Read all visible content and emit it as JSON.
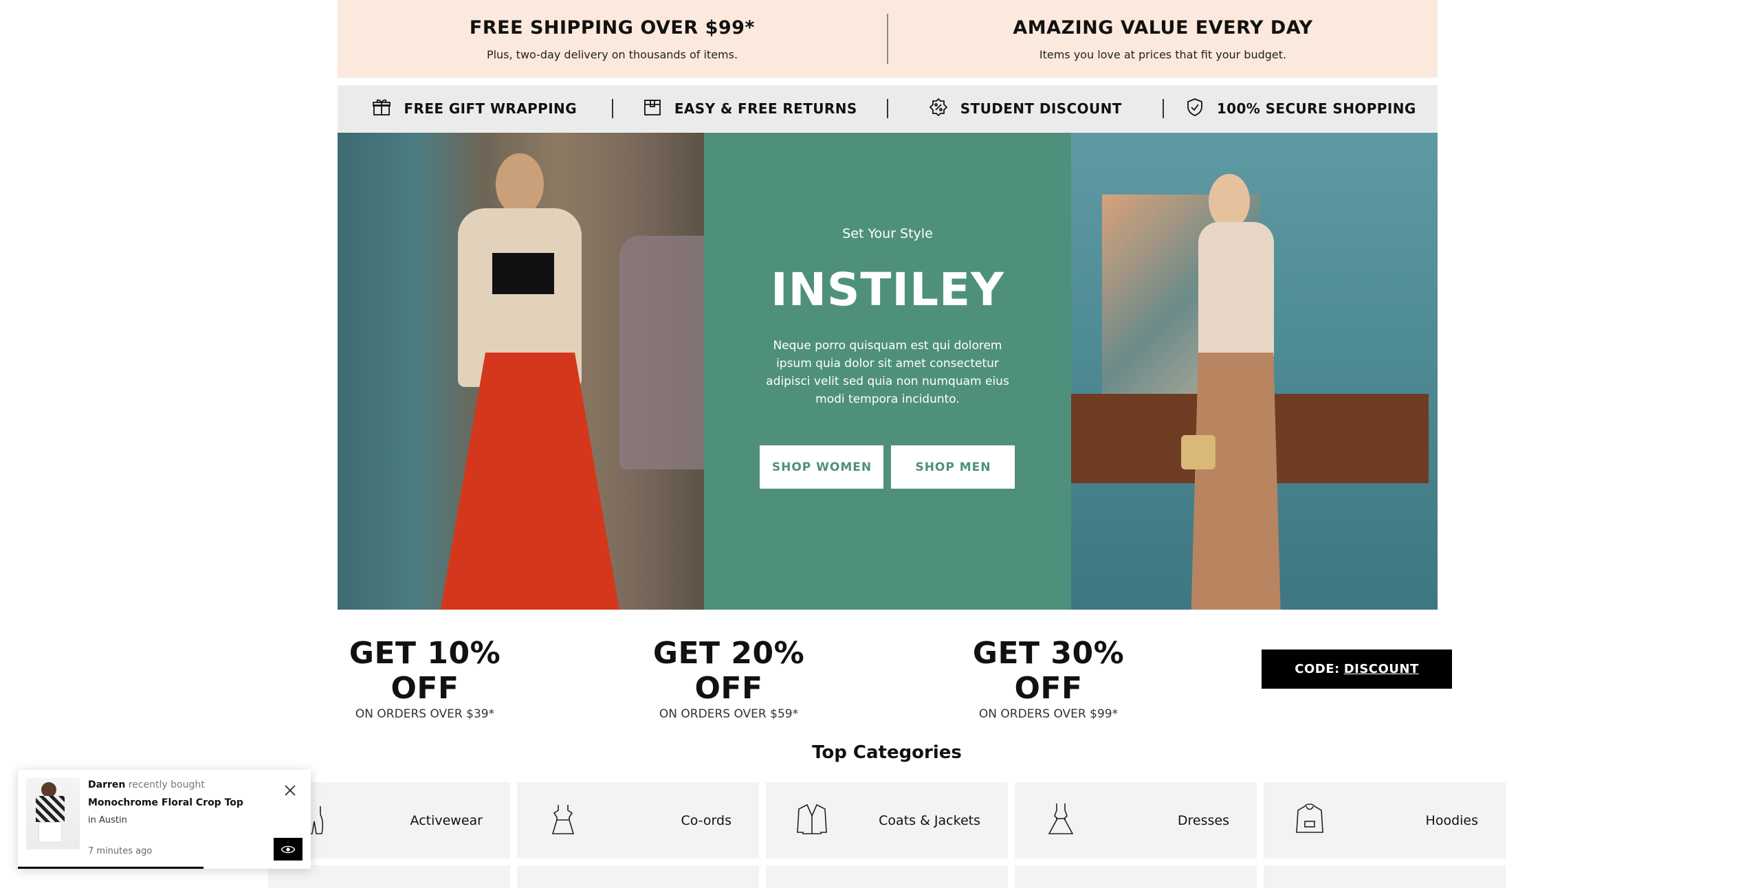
{
  "promo_top": {
    "left": {
      "title": "FREE SHIPPING OVER $99*",
      "subtitle": "Plus, two-day delivery on thousands of items."
    },
    "right": {
      "title": "AMAZING VALUE EVERY DAY",
      "subtitle": "Items you love at prices that fit your budget."
    }
  },
  "features": [
    {
      "label": "FREE GIFT WRAPPING",
      "icon": "gift-icon"
    },
    {
      "label": "EASY & FREE RETURNS",
      "icon": "box-icon"
    },
    {
      "label": "STUDENT DISCOUNT",
      "icon": "discount-badge-icon"
    },
    {
      "label": "100% SECURE SHOPPING",
      "icon": "shield-check-icon"
    }
  ],
  "hero": {
    "eyebrow": "Set Your Style",
    "brand": "INSTILEY",
    "description": "Neque porro quisquam est qui dolorem ipsum quia dolor sit amet consectetur adipisci velit sed quia non numquam eius modi tempora incidunto.",
    "buttons": {
      "women": "SHOP WOMEN",
      "men": "SHOP MEN"
    },
    "accent_color": "#4f907c"
  },
  "discounts": [
    {
      "headline": "GET 10% OFF",
      "sub": "ON ORDERS OVER $39*"
    },
    {
      "headline": "GET 20% OFF",
      "sub": "ON ORDERS OVER $59*"
    },
    {
      "headline": "GET 30% OFF",
      "sub": "ON ORDERS OVER $99*"
    }
  ],
  "code_banner": {
    "prefix": "CODE:",
    "code": "DISCOUNT"
  },
  "categories": {
    "title": "Top Categories",
    "items": [
      {
        "label": "Activewear",
        "icon": "activewear-icon"
      },
      {
        "label": "Co-ords",
        "icon": "dress-coord-icon"
      },
      {
        "label": "Coats & Jackets",
        "icon": "jacket-icon"
      },
      {
        "label": "Dresses",
        "icon": "dress-icon"
      },
      {
        "label": "Hoodies",
        "icon": "hoodie-icon"
      }
    ]
  },
  "toast": {
    "name": "Darren",
    "action": "recently bought",
    "product": "Monochrome Floral Crop Top",
    "location": "in Austin",
    "time": "7 minutes ago"
  }
}
